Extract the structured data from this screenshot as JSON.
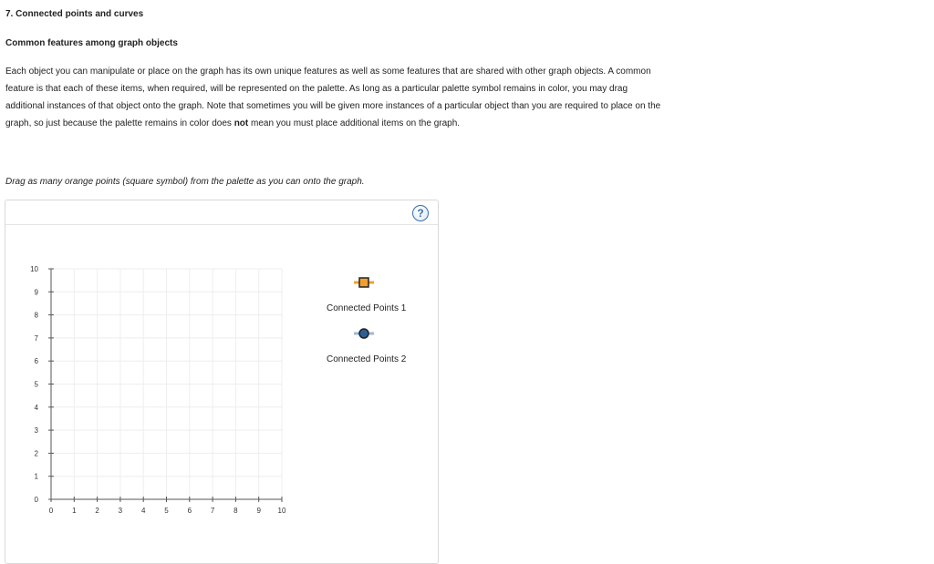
{
  "question": {
    "number_title": "7. Connected points and curves",
    "subheading": "Common features among graph objects",
    "paragraph_part1": "Each object you can manipulate or place on the graph has its own unique features as well as some features that are shared with other graph objects. A common feature is that each of these items, when required, will be represented on the palette. As long as a particular palette symbol remains in color, you may drag additional instances of that object onto the graph. Note that sometimes you will be given more instances of a particular object than you are required to place on the graph, so just because the palette remains in color does ",
    "paragraph_bold": "not",
    "paragraph_part2": " mean you must place additional items on the graph.",
    "instruction": "Drag as many orange points (square symbol) from the palette as you can onto the graph."
  },
  "toolbar": {
    "help_label": "?"
  },
  "graph": {
    "x_ticks": [
      "0",
      "1",
      "2",
      "3",
      "4",
      "5",
      "6",
      "7",
      "8",
      "9",
      "10"
    ],
    "y_ticks": [
      "0",
      "1",
      "2",
      "3",
      "4",
      "5",
      "6",
      "7",
      "8",
      "9",
      "10"
    ],
    "grid_color": "#eeeeee",
    "axis_color": "#555555"
  },
  "palette": {
    "items": [
      {
        "label": "Connected Points 1",
        "icon": "orange-square-point-icon",
        "fill": "#f0a030",
        "stroke": "#222222",
        "line": "#f0a030"
      },
      {
        "label": "Connected Points 2",
        "icon": "blue-circle-point-icon",
        "fill": "#2e5f93",
        "stroke": "#222222",
        "line": "#9fb8d4"
      }
    ]
  }
}
